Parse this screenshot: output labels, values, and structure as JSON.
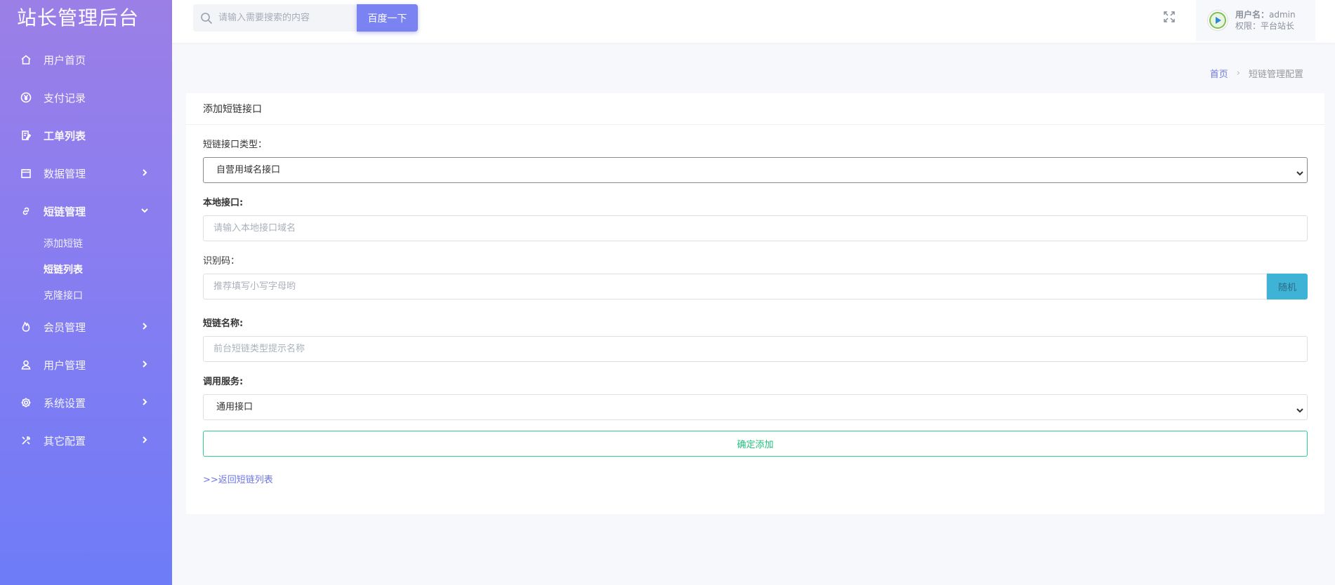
{
  "app": {
    "title": "站长管理后台"
  },
  "sidebar": {
    "items": [
      {
        "label": "用户首页",
        "icon": "home-icon"
      },
      {
        "label": "支付记录",
        "icon": "yen-icon"
      },
      {
        "label": "工单列表",
        "icon": "ticket-icon"
      },
      {
        "label": "数据管理",
        "icon": "calendar-icon"
      },
      {
        "label": "短链管理",
        "icon": "link-icon"
      },
      {
        "label": "会员管理",
        "icon": "flame-icon"
      },
      {
        "label": "用户管理",
        "icon": "user-icon"
      },
      {
        "label": "系统设置",
        "icon": "gear-icon"
      },
      {
        "label": "其它配置",
        "icon": "tools-icon"
      }
    ],
    "subitems": [
      {
        "label": "添加短链"
      },
      {
        "label": "短链列表",
        "active": true
      },
      {
        "label": "克隆接口"
      }
    ]
  },
  "header": {
    "search_placeholder": "请输入需要搜索的内容",
    "search_button": "百度一下",
    "user_name_label": "用户名：",
    "user_name": "admin",
    "role_label": "权限：",
    "role": "平台站长"
  },
  "breadcrumb": {
    "home": "首页",
    "sep": "›",
    "current": "短链管理配置"
  },
  "card": {
    "title": "添加短链接口",
    "type_label": "短链接口类型：",
    "type_value": "自营用域名接口",
    "local_label": "本地接口:",
    "local_placeholder": "请输入本地接口域名",
    "code_label": "识别码：",
    "code_placeholder": "推荐填写小写字母哟",
    "random_button": "随机",
    "name_label": "短链名称:",
    "name_placeholder": "前台短链类型提示名称",
    "service_label": "调用服务:",
    "service_value": "通用接口",
    "submit_button": "确定添加",
    "back_link": ">>返回短链列表"
  },
  "colors": {
    "accent": "#7b83f2",
    "success": "#2fcf8c",
    "info": "#3fb3d6"
  }
}
